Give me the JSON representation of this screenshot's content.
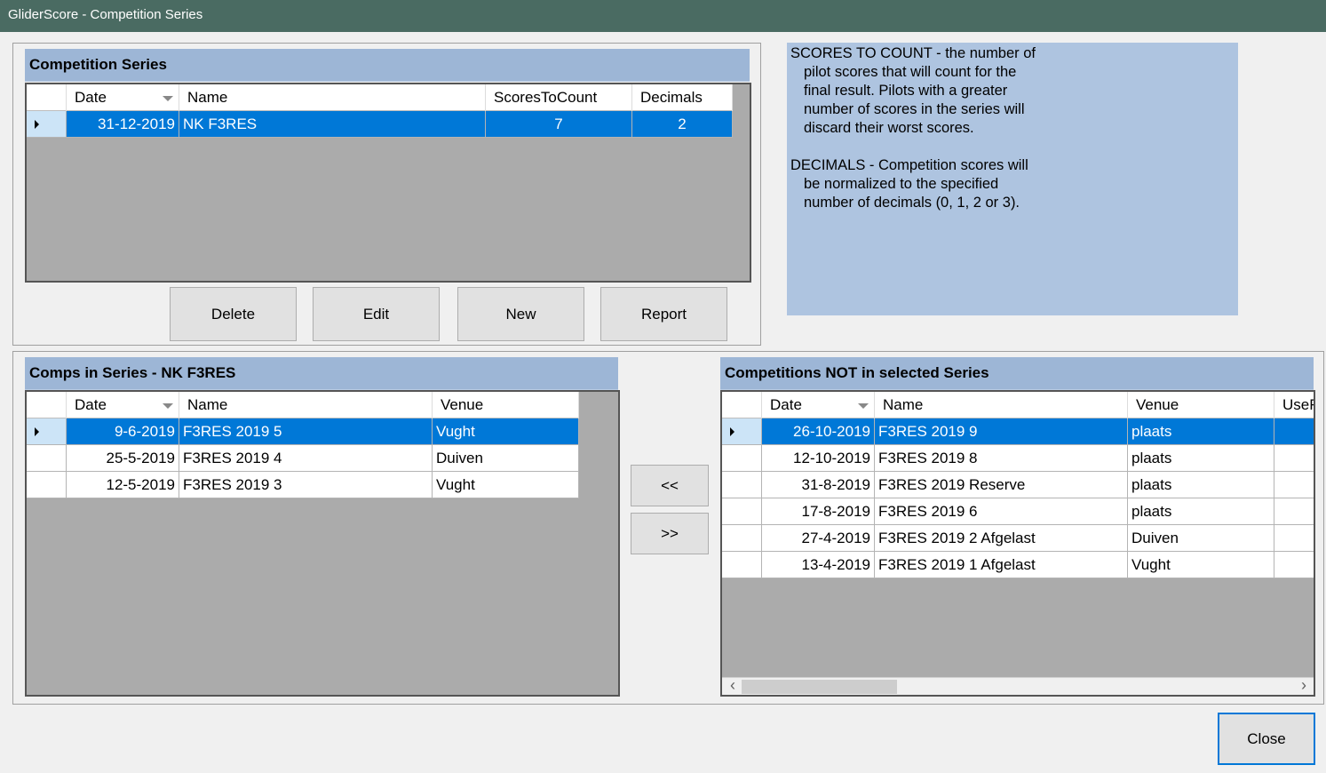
{
  "window": {
    "title": "GliderScore - Competition Series"
  },
  "series_panel": {
    "header": "Competition Series",
    "columns": [
      "Date",
      "Name",
      "ScoresToCount",
      "Decimals"
    ],
    "rows": [
      {
        "date": "31-12-2019",
        "name": "NK F3RES",
        "scores_to_count": "7",
        "decimals": "2",
        "selected": true
      }
    ],
    "buttons": {
      "delete": "Delete",
      "edit": "Edit",
      "new": "New",
      "report": "Report"
    }
  },
  "info": {
    "scores_lines": [
      "SCORES TO COUNT - the number of",
      "pilot scores that will count for the",
      "final result.  Pilots with a greater",
      "number of scores in the series will",
      "discard their worst scores."
    ],
    "decimals_lines": [
      "DECIMALS - Competition scores will",
      "be normalized to the specified",
      "number of decimals (0, 1, 2 or 3)."
    ]
  },
  "comps_in_series": {
    "header": "Comps in Series - NK F3RES",
    "columns": [
      "Date",
      "Name",
      "Venue"
    ],
    "rows": [
      {
        "date": "9-6-2019",
        "name": "F3RES 2019 5",
        "venue": "Vught",
        "selected": true
      },
      {
        "date": "25-5-2019",
        "name": "F3RES 2019 4",
        "venue": "Duiven",
        "selected": false
      },
      {
        "date": "12-5-2019",
        "name": "F3RES 2019 3",
        "venue": "Vught",
        "selected": false
      }
    ]
  },
  "transfer": {
    "add_label": "<<",
    "remove_label": ">>"
  },
  "comps_not_in_series": {
    "header": "Competitions NOT in selected Series",
    "columns": [
      "Date",
      "Name",
      "Venue",
      "UseF"
    ],
    "rows": [
      {
        "date": "26-10-2019",
        "name": "F3RES 2019 9",
        "venue": "plaats",
        "selected": true
      },
      {
        "date": "12-10-2019",
        "name": "F3RES 2019 8",
        "venue": "plaats",
        "selected": false
      },
      {
        "date": "31-8-2019",
        "name": "F3RES 2019 Reserve",
        "venue": "plaats",
        "selected": false
      },
      {
        "date": "17-8-2019",
        "name": "F3RES 2019 6",
        "venue": "plaats",
        "selected": false
      },
      {
        "date": "27-4-2019",
        "name": "F3RES 2019 2 Afgelast",
        "venue": "Duiven",
        "selected": false
      },
      {
        "date": "13-4-2019",
        "name": "F3RES 2019 1 Afgelast",
        "venue": "Vught",
        "selected": false
      }
    ],
    "scroll": {
      "left_arrow": "‹",
      "right_arrow": "›"
    }
  },
  "footer": {
    "close_label": "Close"
  },
  "colors": {
    "selection": "#0078d7",
    "header_band": "#9db6d6",
    "info_bg": "#aec4e0",
    "titlebar": "#4a6b62"
  }
}
